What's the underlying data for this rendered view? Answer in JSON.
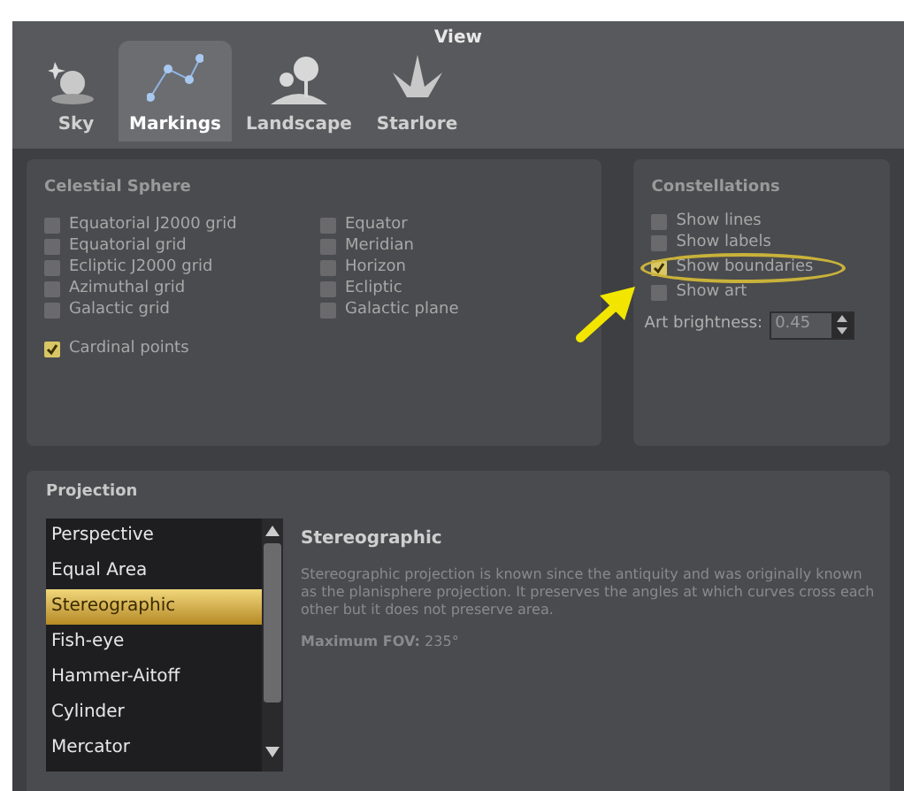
{
  "window": {
    "title": "View"
  },
  "tabs": [
    {
      "label": "Sky",
      "selected": false
    },
    {
      "label": "Markings",
      "selected": true
    },
    {
      "label": "Landscape",
      "selected": false
    },
    {
      "label": "Starlore",
      "selected": false
    }
  ],
  "celestial_sphere": {
    "title": "Celestial Sphere",
    "columns": [
      [
        {
          "label": "Equatorial J2000 grid",
          "checked": false
        },
        {
          "label": "Equatorial grid",
          "checked": false
        },
        {
          "label": "Ecliptic J2000 grid",
          "checked": false
        },
        {
          "label": "Azimuthal grid",
          "checked": false
        },
        {
          "label": "Galactic grid",
          "checked": false
        }
      ],
      [
        {
          "label": "Equator",
          "checked": false
        },
        {
          "label": "Meridian",
          "checked": false
        },
        {
          "label": "Horizon",
          "checked": false
        },
        {
          "label": "Ecliptic",
          "checked": false
        },
        {
          "label": "Galactic plane",
          "checked": false
        }
      ]
    ],
    "cardinal_points": {
      "label": "Cardinal points",
      "checked": true
    }
  },
  "constellations": {
    "title": "Constellations",
    "options": [
      {
        "label": "Show lines",
        "checked": false,
        "highlighted": false
      },
      {
        "label": "Show labels",
        "checked": false,
        "highlighted": false
      },
      {
        "label": "Show boundaries",
        "checked": true,
        "highlighted": true
      },
      {
        "label": "Show art",
        "checked": false,
        "highlighted": false
      }
    ],
    "art_brightness": {
      "label": "Art brightness:",
      "value": "0.45"
    }
  },
  "projection": {
    "title": "Projection",
    "items": [
      {
        "label": "Perspective",
        "selected": false
      },
      {
        "label": "Equal Area",
        "selected": false
      },
      {
        "label": "Stereographic",
        "selected": true
      },
      {
        "label": "Fish-eye",
        "selected": false
      },
      {
        "label": "Hammer-Aitoff",
        "selected": false
      },
      {
        "label": "Cylinder",
        "selected": false
      },
      {
        "label": "Mercator",
        "selected": false
      }
    ],
    "detail": {
      "title": "Stereographic",
      "description": "Stereographic projection is known since the antiquity and was originally known as the planisphere projection. It preserves the angles at which curves cross each other but it does not preserve area.",
      "max_fov": "**Maximum FOV:** 235°"
    }
  }
}
